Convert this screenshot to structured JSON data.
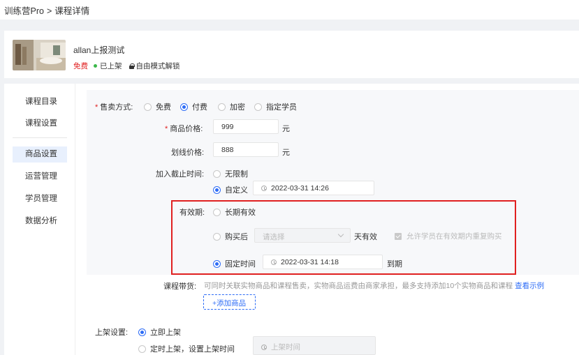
{
  "breadcrumb": {
    "root": "训练营Pro",
    "separator": ">",
    "current": "课程详情"
  },
  "course": {
    "title": "allan上报测试",
    "price": "免费",
    "status": "已上架",
    "mode": "自由模式解锁"
  },
  "sidebar": {
    "items": [
      {
        "label": "课程目录"
      },
      {
        "label": "课程设置"
      },
      {
        "label": "商品设置",
        "active": true
      },
      {
        "label": "运营管理"
      },
      {
        "label": "学员管理"
      },
      {
        "label": "数据分析"
      }
    ]
  },
  "form": {
    "sale_method": {
      "label": "售卖方式:",
      "options": [
        "免费",
        "付费",
        "加密",
        "指定学员"
      ],
      "selected": "付费"
    },
    "price": {
      "label": "商品价格:",
      "value": "999",
      "unit": "元"
    },
    "strike_price": {
      "label": "划线价格:",
      "value": "888",
      "unit": "元"
    },
    "deadline": {
      "label": "加入截止时间:",
      "option_unlimited": "无限制",
      "option_custom": "自定义",
      "custom_value": "2022-03-31 14:26"
    },
    "validity": {
      "label": "有效期:",
      "option_long": "长期有效",
      "option_after": "购买后",
      "after_placeholder": "请选择",
      "after_suffix": "天有效",
      "allow_repurchase": "允许学员在有效期内重复购买",
      "option_fixed": "固定时间",
      "fixed_value": "2022-03-31 14:18",
      "fixed_suffix": "到期"
    },
    "goods": {
      "label": "课程带货:",
      "hint": "可同时关联实物商品和课程售卖，实物商品运费由商家承担，最多支持添加10个实物商品和课程",
      "example_link": "查看示例",
      "add_button": "+添加商品"
    },
    "listing": {
      "label": "上架设置:",
      "option_now": "立即上架",
      "option_scheduled": "定时上架，设置上架时间",
      "time_placeholder": "上架时间"
    }
  },
  "colors": {
    "accent": "#2d6cf6",
    "danger": "#e02020",
    "success": "#3bb84a"
  }
}
